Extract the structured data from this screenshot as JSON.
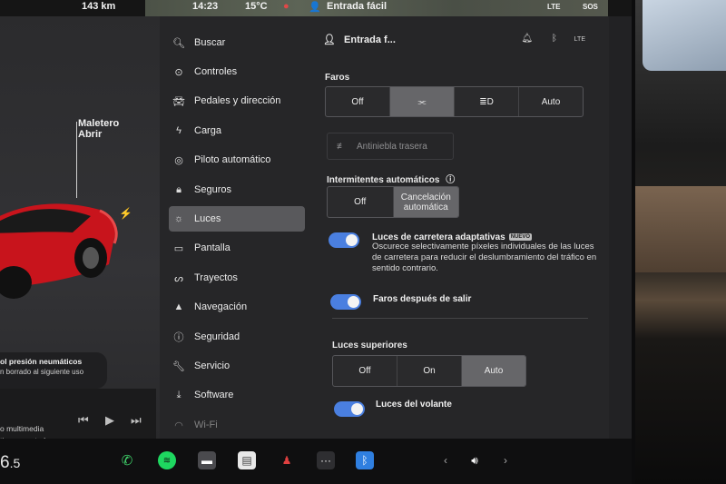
{
  "status": {
    "range": "143 km",
    "time": "14:23",
    "temperature": "15°C",
    "profile": "Entrada fácil",
    "network": "LTE",
    "sos": "SOS"
  },
  "car_panel": {
    "trunk_line1": "Maletero",
    "trunk_line2": "Abrir",
    "tpms_title": "ol presión neumáticos",
    "tpms_sub": "n borrado al siguiente uso",
    "media_line1": "o multimedia",
    "media_line2": "tivo conectado"
  },
  "menu": {
    "search": "Buscar",
    "items": [
      {
        "label": "Controles"
      },
      {
        "label": "Pedales y dirección"
      },
      {
        "label": "Carga"
      },
      {
        "label": "Piloto automático"
      },
      {
        "label": "Seguros"
      },
      {
        "label": "Luces"
      },
      {
        "label": "Pantalla"
      },
      {
        "label": "Trayectos"
      },
      {
        "label": "Navegación"
      },
      {
        "label": "Seguridad"
      },
      {
        "label": "Servicio"
      },
      {
        "label": "Software"
      },
      {
        "label": "Wi-Fi"
      }
    ],
    "active": "Luces"
  },
  "content": {
    "profile": "Entrada f...",
    "network": "LTE",
    "headlights": {
      "title": "Faros",
      "options": [
        "Off",
        "",
        "",
        "Auto"
      ],
      "selected_index": 1
    },
    "rear_fog": "Antiniebla trasera",
    "auto_indicators": {
      "title": "Intermitentes automáticos",
      "options": [
        "Off",
        "Cancelación automática"
      ],
      "selected_index": 1
    },
    "adaptive_high_beam": {
      "label": "Luces de carretera adaptativas",
      "badge": "NUEVO",
      "enabled": true,
      "description": "Oscurece selectivamente píxeles individuales de las luces de carretera para reducir el deslumbramiento del tráfico en sentido contrario."
    },
    "headlights_after_exit": {
      "label": "Faros después de salir",
      "enabled": true
    },
    "top_lights": {
      "title": "Luces superiores",
      "options": [
        "Off",
        "On",
        "Auto"
      ],
      "selected_index": 2
    },
    "steering_lights": {
      "label": "Luces del volante",
      "enabled": true
    }
  },
  "bottom": {
    "temperature_int": "6",
    "temperature_dec": ".5"
  },
  "colors": {
    "toggle_on": "#4a7fe0",
    "car_red": "#c8141c"
  }
}
